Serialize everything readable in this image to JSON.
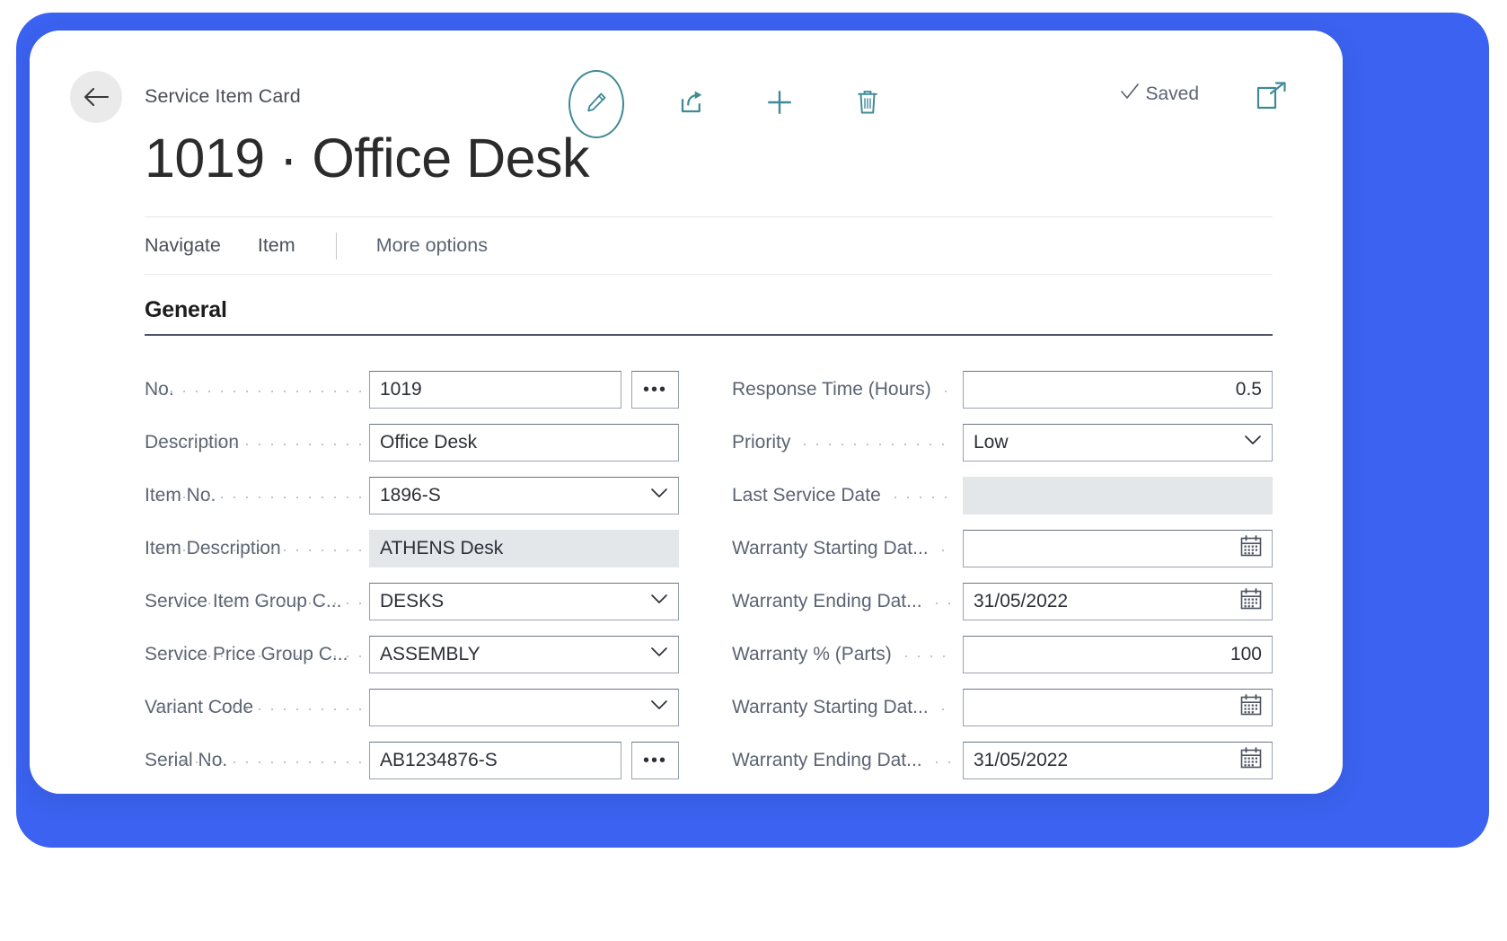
{
  "window": {
    "breadcrumb": "Service Item Card",
    "title": "1019 · Office Desk",
    "saved_label": "Saved",
    "accent_color": "#3f8a96",
    "frame_color": "#3b62f0"
  },
  "toolbar": {
    "back_icon": "back-arrow-icon",
    "edit_icon": "pencil-edit-icon",
    "share_icon": "share-icon",
    "new_icon": "plus-icon",
    "delete_icon": "trash-icon",
    "saved_check_icon": "check-icon",
    "expand_icon": "open-in-new-window-icon"
  },
  "nav": {
    "items": [
      {
        "label": "Navigate"
      },
      {
        "label": "Item"
      },
      {
        "label": "More options"
      }
    ]
  },
  "general": {
    "heading": "General",
    "left_fields": [
      {
        "label": "No.",
        "value": "1019",
        "type": "text-lookup",
        "readonly": false,
        "width": "narrow"
      },
      {
        "label": "Description",
        "value": "Office Desk",
        "type": "text",
        "readonly": false,
        "width": "wide"
      },
      {
        "label": "Item No.",
        "value": "1896-S",
        "type": "dropdown",
        "readonly": false,
        "width": "wide"
      },
      {
        "label": "Item Description",
        "value": "ATHENS Desk",
        "type": "text",
        "readonly": true,
        "width": "wide"
      },
      {
        "label": "Service Item Group C...",
        "value": "DESKS",
        "type": "dropdown",
        "readonly": false,
        "width": "wide"
      },
      {
        "label": "Service Price Group C...",
        "value": "ASSEMBLY",
        "type": "dropdown",
        "readonly": false,
        "width": "wide"
      },
      {
        "label": "Variant Code",
        "value": "",
        "type": "dropdown",
        "readonly": false,
        "width": "wide"
      },
      {
        "label": "Serial No.",
        "value": "AB1234876-S",
        "type": "text-lookup",
        "readonly": false,
        "width": "narrow"
      }
    ],
    "right_fields": [
      {
        "label": "Response Time (Hours)",
        "value": "0.5",
        "type": "number",
        "readonly": false
      },
      {
        "label": "Priority",
        "value": "Low",
        "type": "select",
        "readonly": false
      },
      {
        "label": "Last Service Date",
        "value": "",
        "type": "text",
        "readonly": true
      },
      {
        "label": "Warranty Starting Dat...",
        "value": "",
        "type": "date",
        "readonly": false
      },
      {
        "label": "Warranty Ending Dat...",
        "value": "31/05/2022",
        "type": "date",
        "readonly": false
      },
      {
        "label": "Warranty % (Parts)",
        "value": "100",
        "type": "number",
        "readonly": false
      },
      {
        "label": "Warranty Starting Dat...",
        "value": "",
        "type": "date",
        "readonly": false
      },
      {
        "label": "Warranty Ending Dat...",
        "value": "31/05/2022",
        "type": "date",
        "readonly": false
      }
    ],
    "priority_options": [
      "Low"
    ],
    "ellipsis_label": "•••"
  }
}
